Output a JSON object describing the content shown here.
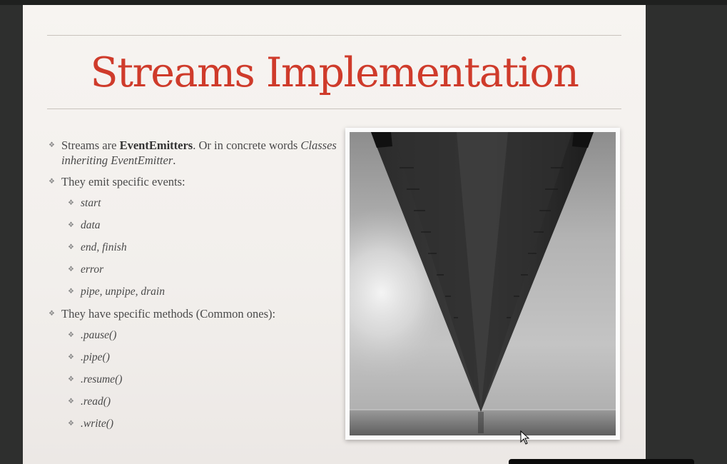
{
  "slide": {
    "title": "Streams Implementation",
    "bullets": [
      {
        "level": 1,
        "parts": [
          {
            "text": "Streams are ",
            "style": "normal"
          },
          {
            "text": "EventEmitters",
            "style": "bold"
          },
          {
            "text": ". Or in concrete words ",
            "style": "normal"
          },
          {
            "text": "Classes inheriting EventEmitter",
            "style": "italic"
          },
          {
            "text": ".",
            "style": "normal"
          }
        ]
      },
      {
        "level": 1,
        "parts": [
          {
            "text": "They emit specific events:",
            "style": "normal"
          }
        ]
      },
      {
        "level": 2,
        "parts": [
          {
            "text": "start",
            "style": "normal"
          }
        ]
      },
      {
        "level": 2,
        "parts": [
          {
            "text": "data",
            "style": "normal"
          }
        ]
      },
      {
        "level": 2,
        "parts": [
          {
            "text": "end, finish",
            "style": "normal"
          }
        ]
      },
      {
        "level": 2,
        "parts": [
          {
            "text": "error",
            "style": "normal"
          }
        ]
      },
      {
        "level": 2,
        "parts": [
          {
            "text": "pipe, unpipe, drain",
            "style": "normal"
          }
        ]
      },
      {
        "level": 1,
        "parts": [
          {
            "text": "They have specific methods (Common ones):",
            "style": "normal"
          }
        ]
      },
      {
        "level": 2,
        "parts": [
          {
            "text": ".pause()",
            "style": "normal"
          }
        ]
      },
      {
        "level": 2,
        "parts": [
          {
            "text": ".pipe()",
            "style": "normal"
          }
        ]
      },
      {
        "level": 2,
        "parts": [
          {
            "text": ".resume()",
            "style": "normal"
          }
        ]
      },
      {
        "level": 2,
        "parts": [
          {
            "text": ".read()",
            "style": "normal"
          }
        ]
      },
      {
        "level": 2,
        "parts": [
          {
            "text": ".write()",
            "style": "normal"
          }
        ]
      }
    ],
    "bullet_glyph": "❖",
    "image": {
      "subject": "bridge-underside-photo"
    }
  },
  "colors": {
    "title": "#cf3b2b",
    "body_text": "#4a4a4a",
    "slide_background": "#f5f2ef",
    "app_background": "#2e2f2e"
  },
  "icons": {
    "cursor": "mouse-pointer-icon",
    "bullet": "diamond-bullet-icon"
  }
}
